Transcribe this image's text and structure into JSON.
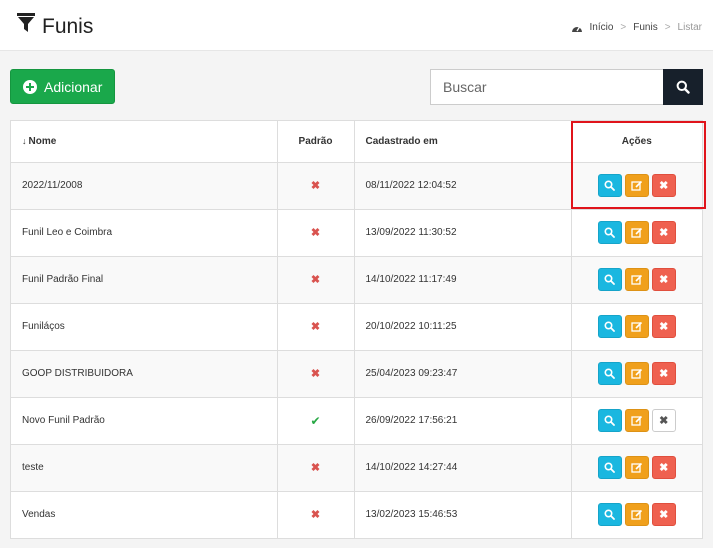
{
  "header": {
    "title": "Funis",
    "breadcrumb": [
      "Início",
      "Funis",
      "Listar"
    ],
    "breadcrumb_separator": ">"
  },
  "toolbar": {
    "add_label": "Adicionar",
    "search_placeholder": "Buscar"
  },
  "table": {
    "columns": [
      "Nome",
      "Padrão",
      "Cadastrado em",
      "Ações"
    ],
    "rows": [
      {
        "name": "2022/11/2008",
        "padrao": "✖",
        "date": "08/11/2022 12:04:52"
      },
      {
        "name": "Funil Leo e Coimbra",
        "padrao": "✖",
        "date": "13/09/2022 11:30:52"
      },
      {
        "name": "Funil Padrão Final",
        "padrao": "✖",
        "date": "14/10/2022 11:17:49"
      },
      {
        "name": "Funiláços",
        "padrao": "✖",
        "date": "20/10/2022 10:11:25"
      },
      {
        "name": "GOOP DISTRIBUIDORA",
        "padrao": "✖",
        "date": "25/04/2023 09:23:47"
      },
      {
        "name": "Novo Funil Padrão",
        "padrao": "✔",
        "date": "26/09/2022 17:56:21"
      },
      {
        "name": "teste",
        "padrao": "✖",
        "date": "14/10/2022 14:27:44"
      },
      {
        "name": "Vendas",
        "padrao": "✖",
        "date": "13/02/2023 15:46:53"
      }
    ]
  },
  "icons": {
    "header": "funnel-icon",
    "breadcrumb": "dashboard-icon",
    "add": "plus-circle-icon",
    "search": "search-icon",
    "sort": "sort-down-icon",
    "row_actions": [
      "view-icon",
      "edit-icon",
      "delete-icon"
    ]
  },
  "colors": {
    "add_button": "#1aa84b",
    "search_button": "#17202b",
    "view_button": "#1ab7e0",
    "edit_button": "#f0a01c",
    "delete_button": "#ef6150",
    "status_no": "#d9534f",
    "status_yes": "#27a844",
    "highlight": "#e0141b"
  }
}
